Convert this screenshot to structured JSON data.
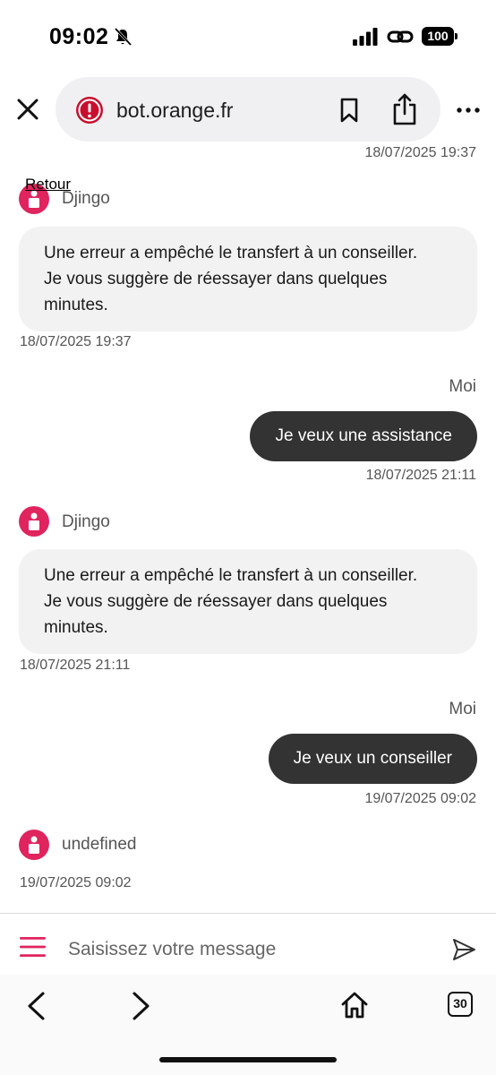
{
  "status": {
    "time": "09:02",
    "battery": "100"
  },
  "browser": {
    "url": "bot.orange.fr",
    "tab_count": "30"
  },
  "chat": {
    "top_timestamp": "18/07/2025 19:37",
    "back_label": "Retour",
    "messages": [
      {
        "sender": "Djingo",
        "lines": [
          "Une erreur a empêché le transfert à un conseiller.",
          "Je vous suggère de réessayer dans quelques",
          "minutes."
        ],
        "timestamp": "18/07/2025 19:37"
      },
      {
        "sender": "Moi",
        "text": "Je veux une assistance",
        "timestamp": "18/07/2025 21:11"
      },
      {
        "sender": "Djingo",
        "lines": [
          "Une erreur a empêché le transfert à un conseiller.",
          "Je vous suggère de réessayer dans quelques",
          "minutes."
        ],
        "timestamp": "18/07/2025 21:11"
      },
      {
        "sender": "Moi",
        "text": "Je veux un conseiller",
        "timestamp": "19/07/2025 09:02"
      },
      {
        "sender": "undefined",
        "timestamp": "19/07/2025 09:02"
      }
    ]
  },
  "input": {
    "placeholder": "Saisissez votre message"
  },
  "colors": {
    "accent": "#e0245e",
    "user_bubble": "#333333",
    "bot_bubble": "#f2f2f2",
    "warning": "#c8102e"
  }
}
